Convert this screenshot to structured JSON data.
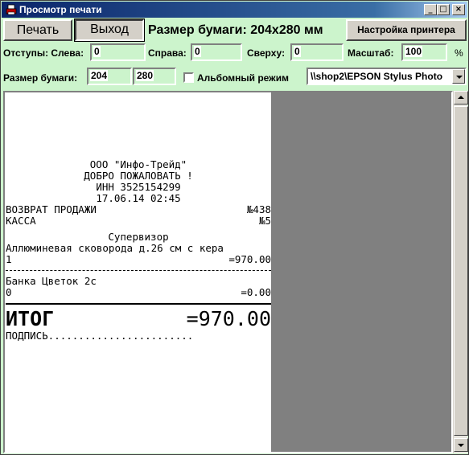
{
  "window": {
    "title": "Просмотр печати"
  },
  "titlebar_buttons": {
    "minimize": "_",
    "maximize": "□",
    "close": "×"
  },
  "toolbar": {
    "print_label": "Печать",
    "exit_label": "Выход",
    "paper_size_text": "Размер бумаги: 204x280 мм",
    "printer_setup_label": "Настройка принтера"
  },
  "margins": {
    "left_label": "Отступы: Слева:",
    "left_value": "0",
    "right_label": "Справа:",
    "right_value": "0",
    "top_label": "Сверху:",
    "top_value": "0",
    "scale_label": "Масштаб:",
    "scale_value": "100",
    "scale_unit": "%"
  },
  "paper": {
    "size_label": "Размер бумаги:",
    "width_value": "204",
    "height_value": "280",
    "landscape_label": "Альбомный режим",
    "landscape_checked": false,
    "printer_selected": "\\\\shop2\\EPSON Stylus Photo"
  },
  "receipt": {
    "company": "ООО \"Инфо-Трейд\"",
    "welcome": "ДОБРО ПОЖАЛОВАТЬ !",
    "inn": "ИНН 3525154299",
    "datetime": "17.06.14 02:45",
    "op_left": "ВОЗВРАТ ПРОДАЖИ",
    "op_right": "№438",
    "kassa_left": "КАССА",
    "kassa_right": "№5",
    "cashier": "Супервизор",
    "item1_name": "Аллюминевая сковорода д.26 см с кера",
    "item1_qty": "1",
    "item1_sum": "=970.00",
    "item2_name": "Банка Цветок 2с",
    "item2_qty": "0",
    "item2_sum": "=0.00",
    "total_label": "ИТОГ",
    "total_value": "=970.00",
    "signature": "ПОДПИСЬ........................"
  }
}
